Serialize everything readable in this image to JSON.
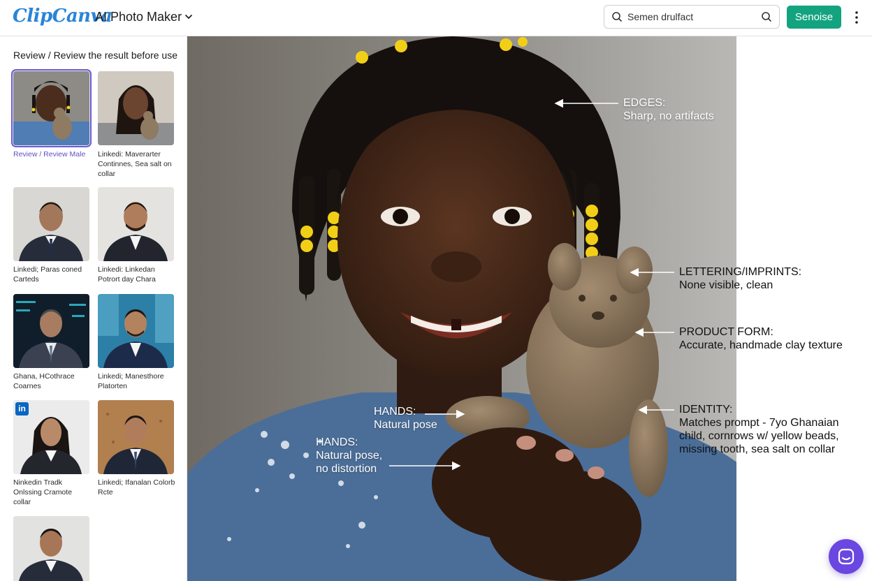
{
  "header": {
    "logo": "ClipCanva",
    "app_title": "AI Photo Maker",
    "search_value": "Semen drulfact",
    "primary_button": "Senoise"
  },
  "sidebar": {
    "breadcrumb": "Review / Review the result before use",
    "thumbnails": [
      {
        "caption": "Review / Review Male",
        "selected": true
      },
      {
        "caption": "Linkedi: Maverarter Continnes, Sea salt on collar",
        "selected": false
      },
      {
        "caption": "Linkedi; Paras coned Carteds",
        "selected": false
      },
      {
        "caption": "Linkedi: Linkedan Potrort day Chara",
        "selected": false
      },
      {
        "caption": "Ghana, HCothrace Coarnes",
        "selected": false
      },
      {
        "caption": "Linkedi; Manesthore Platorten",
        "selected": false
      },
      {
        "caption": "Ninkedin Tradk Onlssing Cramote collar",
        "selected": false,
        "badge": "in"
      },
      {
        "caption": "Linkedi; Ifanalan Colorb Rcte",
        "selected": false
      },
      {
        "caption": "",
        "selected": false
      }
    ]
  },
  "annotations": {
    "edges": {
      "head": "EDGES:",
      "body": "Sharp, no artifacts"
    },
    "lettering": {
      "head": "LETTERING/IMPRINTS:",
      "body": "None visible, clean"
    },
    "product": {
      "head": "PRODUCT FORM:",
      "body": "Accurate, handmade clay texture"
    },
    "identity": {
      "head": "IDENTITY:",
      "body": "Matches prompt - 7yo Ghanaian child, cornrows w/ yellow beads, missing tooth, sea salt on collar"
    },
    "hands1": {
      "head": "HANDS:",
      "body": "Natural pose"
    },
    "hands2": {
      "head": "HANDS:",
      "body": "Natural pose, no distortion"
    }
  },
  "colors": {
    "accent_green": "#14a37f",
    "logo_blue": "#2a84d8",
    "selection_purple": "#6c5ccf",
    "chat_purple": "#6a47e0",
    "linkedin_blue": "#0a66c2"
  },
  "icons": [
    "chevron-down-icon",
    "search-icon",
    "kebab-menu-icon",
    "chat-icon",
    "linkedin-icon"
  ]
}
